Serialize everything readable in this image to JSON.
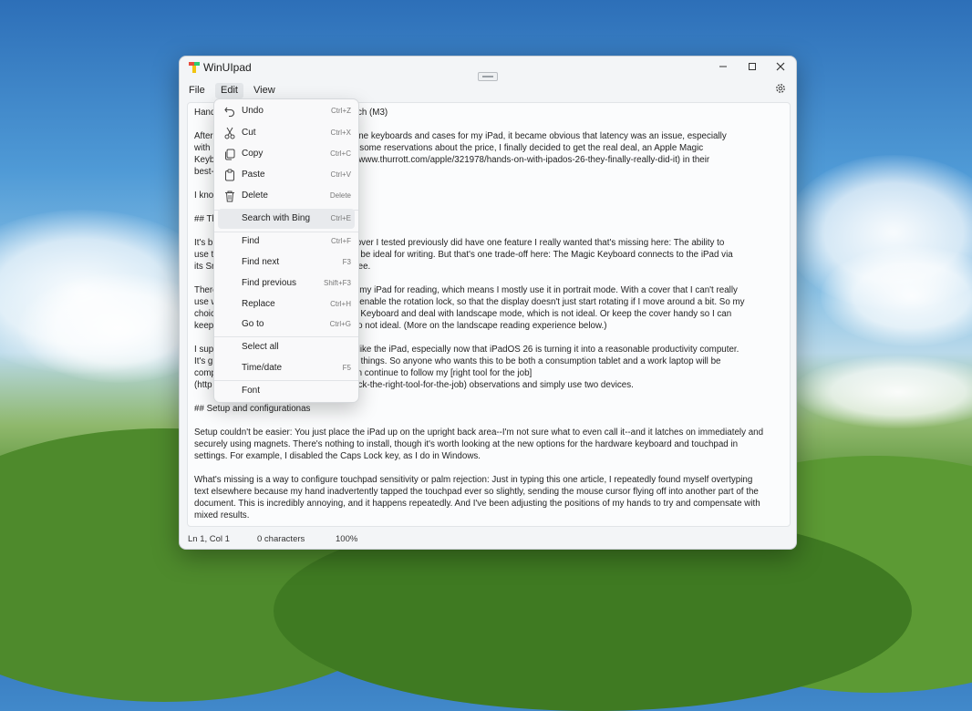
{
  "window": {
    "title": "WinUIpad"
  },
  "menubar": {
    "file": "File",
    "edit": "Edit",
    "view": "View"
  },
  "edit_menu": [
    {
      "label": "Undo",
      "shortcut": "Ctrl+Z",
      "icon": "undo-icon"
    },
    {
      "label": "Cut",
      "shortcut": "Ctrl+X",
      "icon": "scissors-icon"
    },
    {
      "label": "Copy",
      "shortcut": "Ctrl+C",
      "icon": "copy-icon"
    },
    {
      "label": "Paste",
      "shortcut": "Ctrl+V",
      "icon": "paste-icon"
    },
    {
      "label": "Delete",
      "shortcut": "Delete",
      "icon": "trash-icon"
    },
    {
      "label": "Search with Bing",
      "shortcut": "Ctrl+E"
    },
    {
      "label": "Find",
      "shortcut": "Ctrl+F"
    },
    {
      "label": "Find next",
      "shortcut": "F3"
    },
    {
      "label": "Find previous",
      "shortcut": "Shift+F3"
    },
    {
      "label": "Replace",
      "shortcut": "Ctrl+H"
    },
    {
      "label": "Go to",
      "shortcut": "Ctrl+G"
    },
    {
      "label": "Select all",
      "shortcut": ""
    },
    {
      "label": "Time/date",
      "shortcut": "F5"
    },
    {
      "label": "Font",
      "shortcut": ""
    }
  ],
  "document": {
    "p1": "Hand                                         d Air 11-Inch (M3)",
    "p2": "After                                          d standalone keyboards and cases for my iPad, it became obvious that latency was an issue, especially\nwith                                               Despite some reservations about the price, I finally decided to get the real deal, an Apple Magic\nKeyb                                              (https://www.thurrott.com/apple/321978/hands-on-with-ipados-26-they-finally-really-did-it) in their\nbest-",
    "p3": "I kno",
    "p4": "## Th",
    "p5": "It's b                                            yboard cover I tested previously did have one feature I really wanted that's missing here: The ability to\nuse t                                               l would be ideal for writing. But that's one trade-off here: The Magic Keyboard connects to the iPad via\nits Sn                                             tency-free.",
    "p6": "There                                            stly use my iPad for reading, which means I mostly use it in portrait mode. With a cover that I can't really\nuse w                                             usually enable the rotation lock, so that the display doesn't just start rotating if I move around a bit. So my\nchoic                                             e Magic Keyboard and deal with landscape mode, which is not ideal. Or keep the cover handy so I can\nkeep                                             ch is also not ideal. (More on the landscape reading experience below.)",
    "p7": "I sup                                             devices like the iPad, especially now that iPadOS 26 is turning it into a reasonable productivity computer.\nIt's g                                               not two things. So anyone who wants this to be both a consumption tablet and a work laptop will be\ncomp                                             nnot can continue to follow my [right tool for the job]\n(http                                              throwback-the-right-tool-for-the-job) observations and simply use two devices.",
    "p8": "## Setup and configurationas",
    "p9": "Setup couldn't be easier: You just place the iPad up on the upright back area--I'm not sure what to even call it--and it latches on immediately and\nsecurely using magnets. There's nothing to install, though it's worth looking at the new options for the hardware keyboard and touchpad in\nsettings. For example, I disabled the Caps Lock key, as I do in Windows.",
    "p10": "What's missing is a way to configure touchpad sensitivity or palm rejection: Just in typing this one article, I repeatedly found myself overtyping\ntext elsewhere because my hand inadvertently tapped the touchpad ever so slightly, sending the mouse cursor flying off into another part of the\ndocument. This is incredibly annoying, and it happens repeatedly. And I've been adjusting the positions of my hands to try and compensate with\nmixed results."
  },
  "status": {
    "position": "Ln 1, Col 1",
    "characters": "0 characters",
    "zoom": "100%"
  },
  "colors": {
    "accent": "#e8eaed",
    "window_bg": "#f3f5f7"
  }
}
